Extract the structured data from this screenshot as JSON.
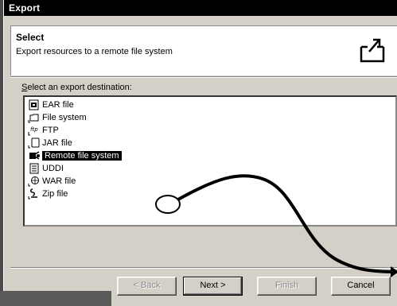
{
  "window": {
    "title": "Export"
  },
  "banner": {
    "title": "Select",
    "description": "Export resources to a remote file system",
    "icon": "export-arrow-icon"
  },
  "prompt": {
    "mnemonic": "S",
    "rest": "elect an export destination:"
  },
  "list": {
    "items": [
      {
        "label": "EAR file",
        "icon": "ear-file-icon"
      },
      {
        "label": "File system",
        "icon": "folder-icon"
      },
      {
        "label": "FTP",
        "icon": "ftp-icon"
      },
      {
        "label": "JAR file",
        "icon": "jar-file-icon"
      },
      {
        "label": "Remote file system",
        "icon": "remote-file-system-icon",
        "selected": true
      },
      {
        "label": "UDDI",
        "icon": "uddi-icon"
      },
      {
        "label": "WAR file",
        "icon": "war-file-icon"
      },
      {
        "label": "Zip file",
        "icon": "zip-file-icon"
      }
    ]
  },
  "buttons": {
    "back": {
      "mnemonic": "B",
      "text": "< Back",
      "enabled": false
    },
    "next": {
      "mnemonic": "N",
      "text": "Next >",
      "enabled": true
    },
    "finish": {
      "mnemonic": "F",
      "text": "Finish",
      "enabled": false
    },
    "cancel": {
      "text": "Cancel",
      "enabled": true
    }
  },
  "colors": {
    "selection": "#000000",
    "window_bg": "#d4d0c8",
    "titlebar": "#000000"
  }
}
